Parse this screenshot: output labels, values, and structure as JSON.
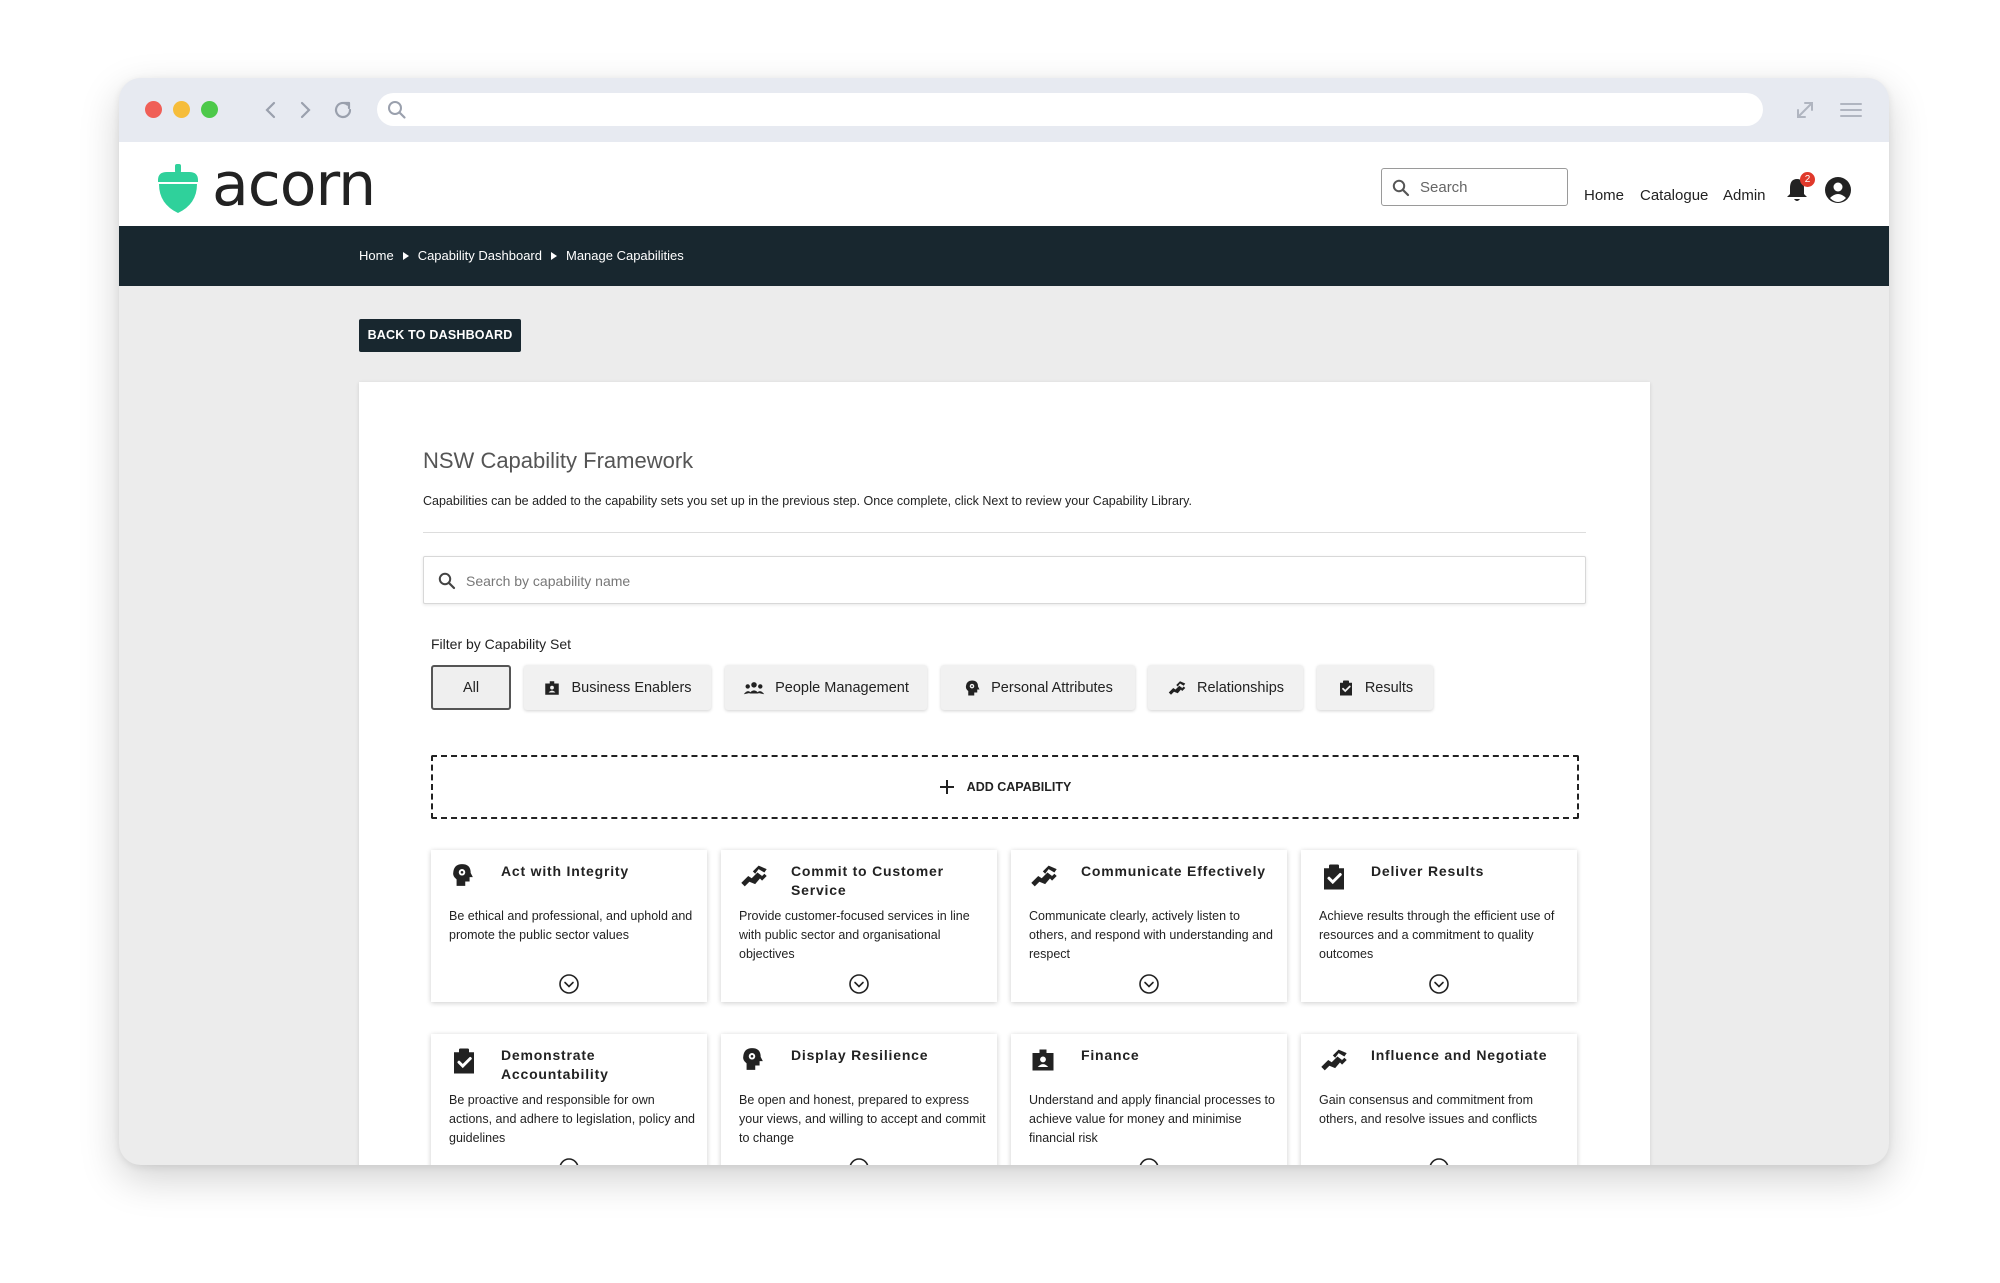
{
  "app": {
    "name": "acorn",
    "brand_color": "#2fd19b",
    "nav_dark": "#18272f"
  },
  "header": {
    "search_placeholder": "Search",
    "links": [
      "Home",
      "Catalogue",
      "Admin"
    ],
    "notification_count": "2"
  },
  "breadcrumb": [
    "Home",
    "Capability Dashboard",
    "Manage Capabilities"
  ],
  "back_button": "BACK TO DASHBOARD",
  "panel": {
    "title": "NSW Capability Framework",
    "description": "Capabilities can be added to the capability sets you set up in the previous step. Once complete, click Next to review your Capability Library.",
    "search_placeholder": "Search by capability name",
    "filter_label": "Filter by Capability Set",
    "filters": [
      {
        "label": "All",
        "icon": "",
        "active": true
      },
      {
        "label": "Business Enablers",
        "icon": "badge-icon"
      },
      {
        "label": "People Management",
        "icon": "people-icon"
      },
      {
        "label": "Personal Attributes",
        "icon": "head-gear-icon"
      },
      {
        "label": "Relationships",
        "icon": "handshake-icon"
      },
      {
        "label": "Results",
        "icon": "clipboard-check-icon"
      }
    ],
    "add_capability": "ADD CAPABILITY",
    "cards": [
      {
        "title": "Act with Integrity",
        "desc": "Be ethical and professional, and uphold and promote the public sector values",
        "icon": "head-gear-icon"
      },
      {
        "title": "Commit to Customer Service",
        "desc": "Provide customer-focused services in line with public sector and organisational objectives",
        "icon": "handshake-icon"
      },
      {
        "title": "Communicate Effectively",
        "desc": "Communicate clearly, actively listen to others, and respond with understanding and respect",
        "icon": "handshake-icon"
      },
      {
        "title": "Deliver Results",
        "desc": "Achieve results through the efficient use of resources and a commitment to quality outcomes",
        "icon": "clipboard-check-icon"
      },
      {
        "title": "Demonstrate Accountability",
        "desc": "Be proactive and responsible for own actions, and adhere to legislation, policy and guidelines",
        "icon": "clipboard-check-icon"
      },
      {
        "title": "Display Resilience",
        "desc": "Be open and honest, prepared to express your views, and willing to accept and commit to change",
        "icon": "head-gear-icon"
      },
      {
        "title": "Finance",
        "desc": "Understand and apply financial processes to achieve value for money and minimise financial risk",
        "icon": "badge-icon"
      },
      {
        "title": "Influence and Negotiate",
        "desc": "Gain consensus and commitment from others, and resolve issues and conflicts",
        "icon": "handshake-icon"
      }
    ]
  }
}
